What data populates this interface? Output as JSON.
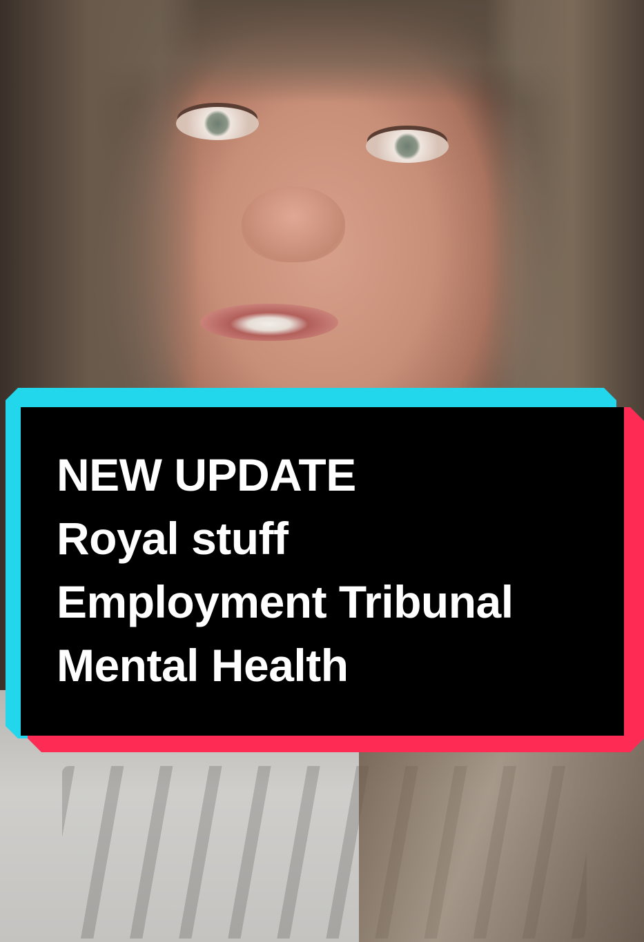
{
  "caption": {
    "lines": [
      "NEW UPDATE",
      "Royal stuff",
      "Employment Tribunal",
      "Mental Health"
    ]
  },
  "colors": {
    "caption_background": "#000000",
    "caption_text": "#ffffff",
    "accent_cyan": "#22d6ec",
    "accent_red": "#fe2c55"
  }
}
